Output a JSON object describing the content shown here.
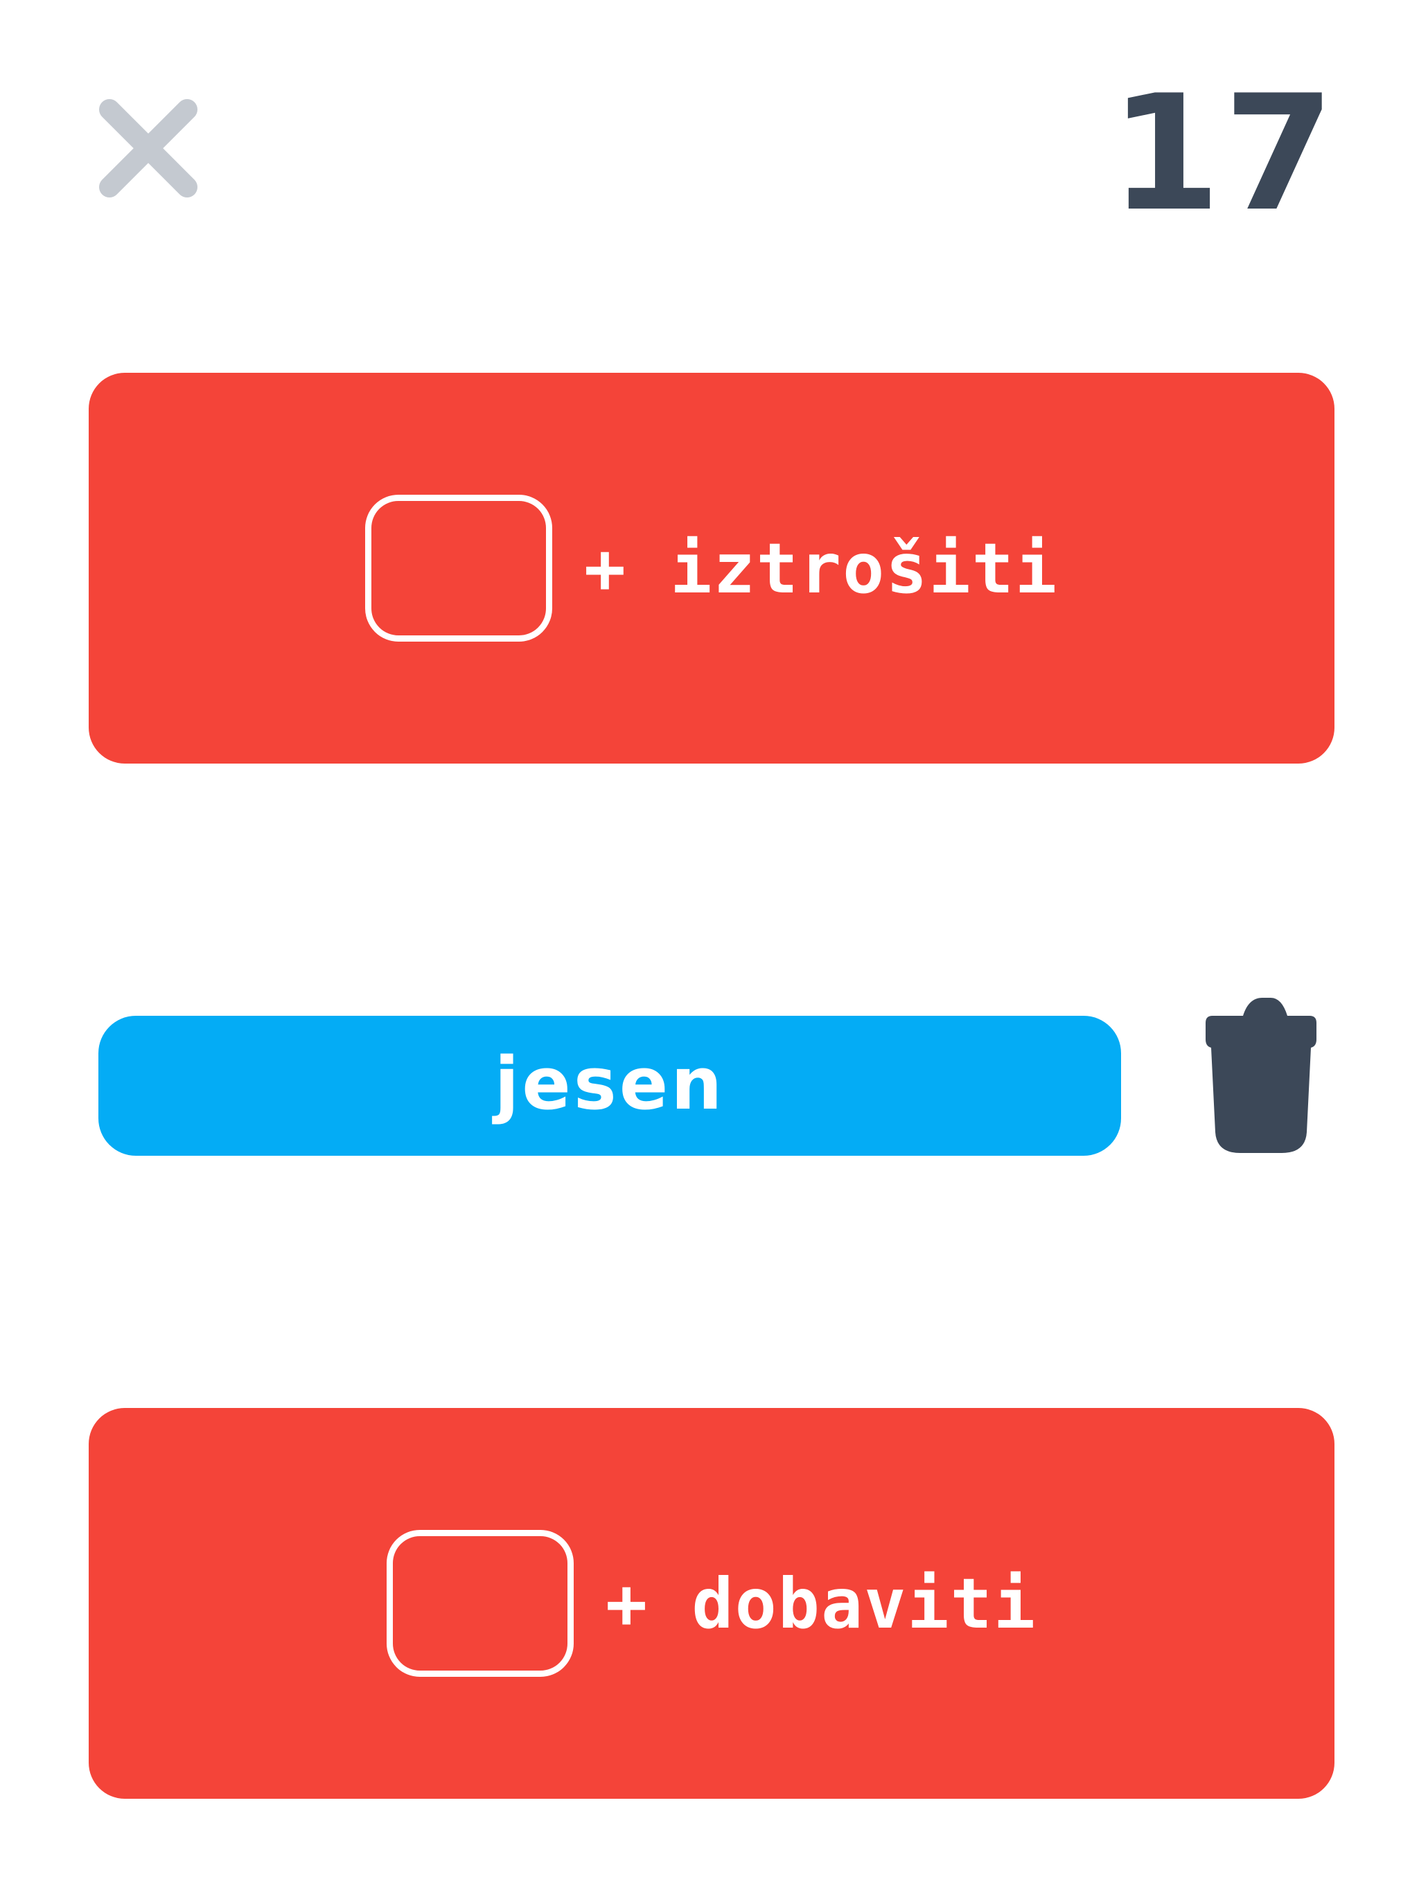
{
  "header": {
    "close_icon": "close-icon",
    "counter": "17"
  },
  "cards": {
    "top": {
      "label": "+ iztrošiti"
    },
    "bottom": {
      "label": "+ dobaviti"
    }
  },
  "word": {
    "text": "jesen"
  },
  "trash": {
    "icon": "trash-icon"
  },
  "colors": {
    "card": "#f44439",
    "word": "#04acf5",
    "dark": "#3c4858",
    "close": "#c4c9d0"
  }
}
